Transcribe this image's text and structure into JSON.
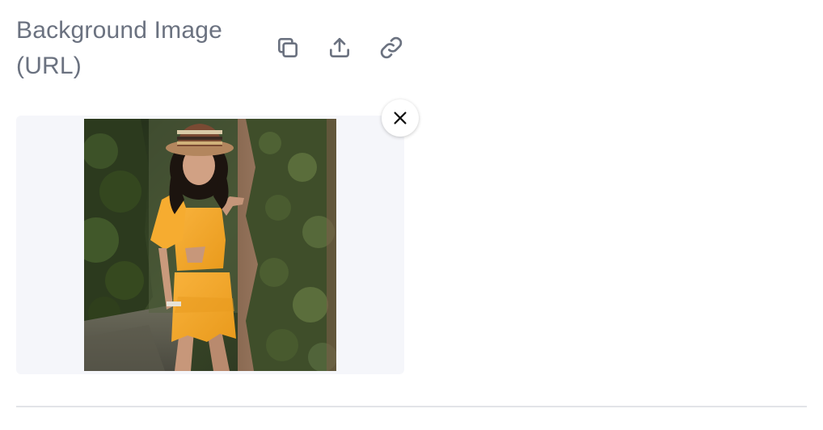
{
  "field": {
    "label": "Background Image (URL)"
  },
  "toolbar": {
    "copy_icon": "copy-icon",
    "upload_icon": "upload-icon",
    "link_icon": "link-icon"
  },
  "preview": {
    "remove_icon": "close-icon",
    "background_color": "#f5f6fa",
    "dress_color": "#f4a328"
  }
}
